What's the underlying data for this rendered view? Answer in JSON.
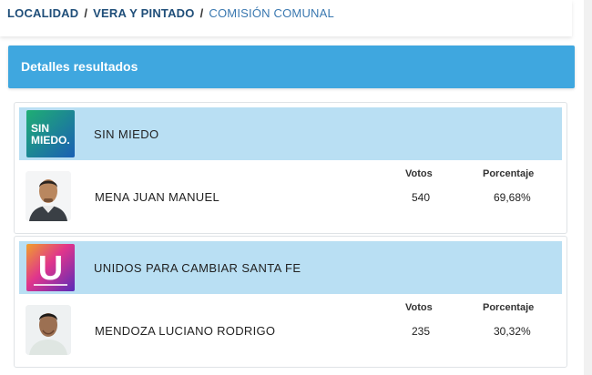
{
  "breadcrumb": {
    "items": [
      "LOCALIDAD",
      "VERA Y PINTADO",
      "COMISIÓN COMUNAL"
    ],
    "separator": "/"
  },
  "details": {
    "title": "Detalles resultados"
  },
  "columns": {
    "votes_label": "Votos",
    "percent_label": "Porcentaje"
  },
  "results": [
    {
      "party": "SIN MIEDO",
      "party_logo_text": "SIN MIEDO.",
      "logo_colors": [
        "#1e9e6e",
        "#1a5fb4"
      ],
      "candidate": "MENA JUAN MANUEL",
      "votes": "540",
      "percent": "69,68%"
    },
    {
      "party": "UNIDOS PARA CAMBIAR SANTA FE",
      "party_logo_text": "U",
      "logo_colors": [
        "#e0358c",
        "#6a2bb8"
      ],
      "candidate": "MENDOZA LUCIANO RODRIGO",
      "votes": "235",
      "percent": "30,32%"
    }
  ],
  "colors": {
    "breadcrumb": "#1f4e79",
    "header_bg": "#3fa7df",
    "party_row_bg": "#b9dff3"
  }
}
